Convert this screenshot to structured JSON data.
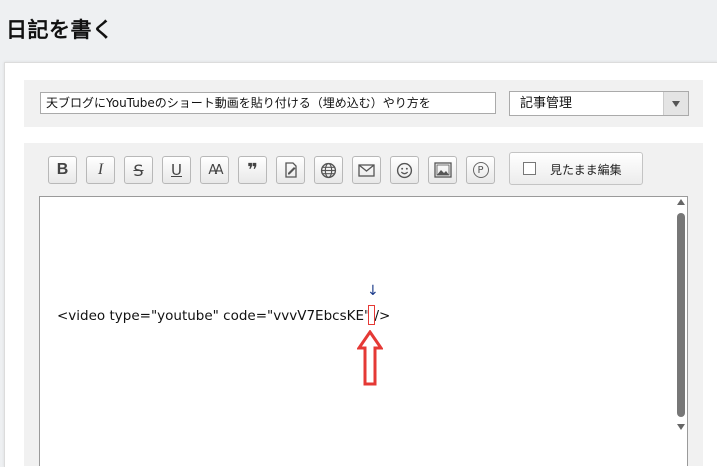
{
  "page": {
    "title": "日記を書く"
  },
  "entry": {
    "title_value": "天ブログにYouTubeのショート動画を貼り付ける（埋め込む）やり方を",
    "category_selected": "記事管理"
  },
  "toolbar": {
    "buttons": [
      {
        "icon": "bold-icon",
        "glyph": "B"
      },
      {
        "icon": "italic-icon",
        "glyph": "I"
      },
      {
        "icon": "strikethrough-icon",
        "glyph": "S"
      },
      {
        "icon": "underline-icon",
        "glyph": "U"
      },
      {
        "icon": "font-size-icon",
        "glyph": "AA"
      },
      {
        "icon": "quote-icon",
        "glyph": "❞"
      },
      {
        "icon": "edit-document-icon",
        "glyph": ""
      },
      {
        "icon": "globe-link-icon",
        "glyph": ""
      },
      {
        "icon": "mail-icon",
        "glyph": ""
      },
      {
        "icon": "emoji-icon",
        "glyph": ""
      },
      {
        "icon": "image-icon",
        "glyph": ""
      },
      {
        "icon": "p-circle-icon",
        "glyph": "P"
      }
    ],
    "wysiwyg_label": "見たまま編集",
    "wysiwyg_checked": false
  },
  "editor": {
    "code_text": "<video type=\"youtube\" code=\"vvvV7EbcsKE\" />",
    "annotation_arrow_small": "↓",
    "annotation_color": "#e53935"
  }
}
